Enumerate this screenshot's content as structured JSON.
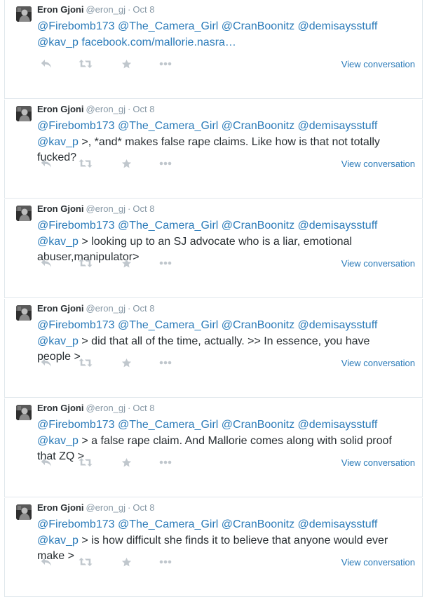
{
  "icons": {
    "avatar": "user-avatar",
    "reply": "reply-icon",
    "retweet": "retweet-icon",
    "favorite": "star-icon",
    "more": "more-dots-icon"
  },
  "colors": {
    "link": "#2b7bb9",
    "text": "#292f33",
    "muted": "#8899a6",
    "icon": "#c0c7cd",
    "border": "#e1e8ed"
  },
  "tweets": [
    {
      "fullname": "Eron Gjoni",
      "username": "@eron_gj",
      "separator": "·",
      "time": "Oct 8",
      "line1": "@Firebomb173 @The_Camera_Girl @CranBoonitz @demisaysstuff",
      "mention_prefix": "@kav_p",
      "line2_rest": " facebook.com/mallorie.nasra…",
      "link_style": true,
      "view_conversation": "View conversation"
    },
    {
      "fullname": "Eron Gjoni",
      "username": "@eron_gj",
      "separator": "·",
      "time": "Oct 8",
      "line1": "@Firebomb173 @The_Camera_Girl @CranBoonitz @demisaysstuff",
      "mention_prefix": "@kav_p",
      "line2_rest": " >, *and* makes false rape claims. Like how is that not totally\nfucked?",
      "link_style": false,
      "view_conversation": "View conversation"
    },
    {
      "fullname": "Eron Gjoni",
      "username": "@eron_gj",
      "separator": "·",
      "time": "Oct 8",
      "line1": "@Firebomb173 @The_Camera_Girl @CranBoonitz @demisaysstuff",
      "mention_prefix": "@kav_p",
      "line2_rest": " > looking up to an SJ advocate who is a liar, emotional\nabuser,manipulator>",
      "link_style": false,
      "view_conversation": "View conversation"
    },
    {
      "fullname": "Eron Gjoni",
      "username": "@eron_gj",
      "separator": "·",
      "time": "Oct 8",
      "line1": "@Firebomb173 @The_Camera_Girl @CranBoonitz @demisaysstuff",
      "mention_prefix": "@kav_p",
      "line2_rest": " > did that all of the time, actually. >> In essence, you have\npeople >",
      "link_style": false,
      "view_conversation": "View conversation"
    },
    {
      "fullname": "Eron Gjoni",
      "username": "@eron_gj",
      "separator": "·",
      "time": "Oct 8",
      "line1": "@Firebomb173 @The_Camera_Girl @CranBoonitz @demisaysstuff",
      "mention_prefix": "@kav_p",
      "line2_rest": " > a false rape claim. And Mallorie comes along with solid proof\nthat ZQ >",
      "link_style": false,
      "view_conversation": "View conversation"
    },
    {
      "fullname": "Eron Gjoni",
      "username": "@eron_gj",
      "separator": "·",
      "time": "Oct 8",
      "line1": "@Firebomb173 @The_Camera_Girl @CranBoonitz @demisaysstuff",
      "mention_prefix": "@kav_p",
      "line2_rest": " > is how difficult she finds it to believe that anyone would ever\nmake >",
      "link_style": false,
      "view_conversation": "View conversation"
    }
  ]
}
